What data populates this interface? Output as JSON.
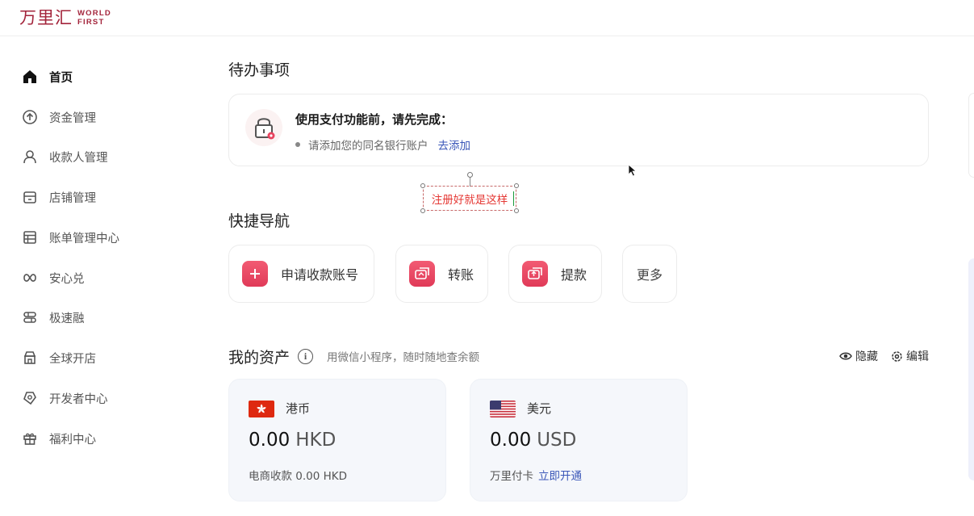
{
  "header": {
    "logo_cn": "万里汇",
    "logo_en_line1": "WORLD",
    "logo_en_line2": "FIRST"
  },
  "sidebar": {
    "items": [
      {
        "label": "首页",
        "icon": "home-icon",
        "active": true
      },
      {
        "label": "资金管理",
        "icon": "arrow-up-circle-icon"
      },
      {
        "label": "收款人管理",
        "icon": "person-icon"
      },
      {
        "label": "店铺管理",
        "icon": "store-icon"
      },
      {
        "label": "账单管理中心",
        "icon": "bill-icon"
      },
      {
        "label": "安心兑",
        "icon": "exchange-icon"
      },
      {
        "label": "极速融",
        "icon": "finance-icon"
      },
      {
        "label": "全球开店",
        "icon": "shop-icon"
      },
      {
        "label": "开发者中心",
        "icon": "developer-icon"
      },
      {
        "label": "福利中心",
        "icon": "gift-icon"
      }
    ]
  },
  "todo": {
    "title": "待办事项",
    "card_title": "使用支付功能前，请先完成：",
    "task": "请添加您的同名银行账户",
    "task_link": "去添加"
  },
  "annotation": {
    "text": "注册好就是这样"
  },
  "quick_nav": {
    "title": "快捷导航",
    "items": [
      {
        "label": "申请收款账号",
        "icon": "plus-icon"
      },
      {
        "label": "转账",
        "icon": "transfer-icon"
      },
      {
        "label": "提款",
        "icon": "withdraw-icon"
      },
      {
        "label": "更多"
      }
    ]
  },
  "assets": {
    "title": "我的资产",
    "subtitle": "用微信小程序，随时随地查余额",
    "hide_label": "隐藏",
    "edit_label": "编辑",
    "cards": [
      {
        "currency": "港币",
        "amount": "0.00",
        "unit": "HKD",
        "footer": "电商收款 0.00 HKD",
        "flag": "hk-flag-icon"
      },
      {
        "currency": "美元",
        "amount": "0.00",
        "unit": "USD",
        "footer": "万里付卡",
        "footer_link": "立即开通",
        "flag": "us-flag-icon"
      }
    ]
  },
  "colors": {
    "brand": "#a3243b",
    "accent": "#e8435e",
    "link": "#3a56b8"
  }
}
